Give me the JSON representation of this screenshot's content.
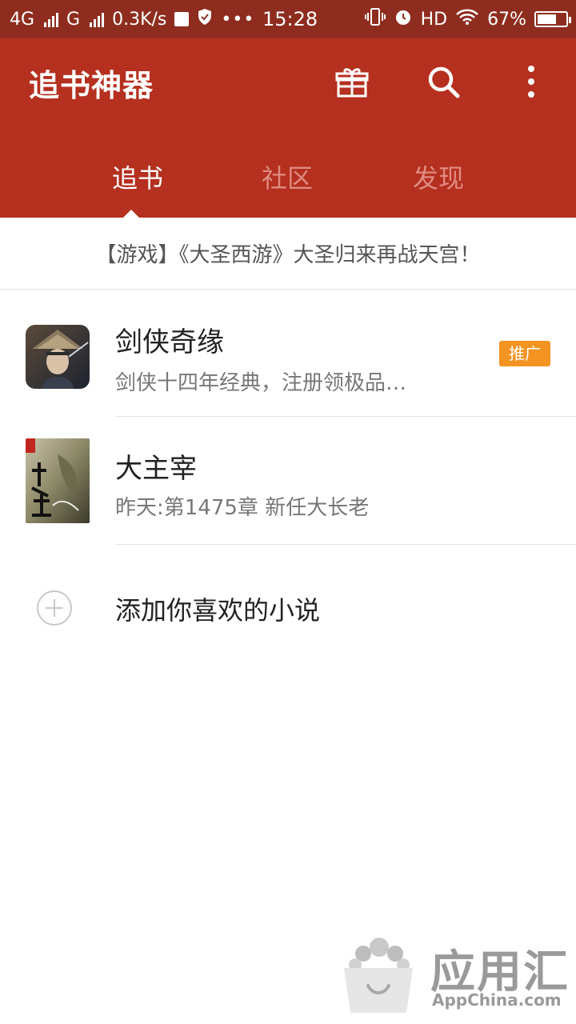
{
  "status_bar": {
    "network_1": "4G",
    "network_2": "G",
    "speed": "0.3K/s",
    "time": "15:28",
    "hd": "HD",
    "battery_percent": "67%",
    "battery_level": 0.67
  },
  "app_bar": {
    "title": "追书神器",
    "icons": [
      "gift-icon",
      "search-icon",
      "more-icon"
    ]
  },
  "tabs": [
    {
      "label": "追书",
      "active": true
    },
    {
      "label": "社区",
      "active": false
    },
    {
      "label": "发现",
      "active": false
    }
  ],
  "banner": {
    "text": "【游戏】《大圣西游》大圣归来再战天宫！"
  },
  "books": [
    {
      "title": "剑侠奇缘",
      "subtitle": "剑侠十四年经典，注册领极品…",
      "badge": "推广"
    },
    {
      "title": "大主宰",
      "subtitle": "昨天:第1475章 新任大长老"
    }
  ],
  "add_book": {
    "label": "添加你喜欢的小说"
  },
  "watermark": {
    "main": "应用汇",
    "sub": "AppChina.com"
  },
  "colors": {
    "status_bar": "#8e2d1f",
    "app_bar": "#b5301f",
    "badge": "#f39322"
  }
}
